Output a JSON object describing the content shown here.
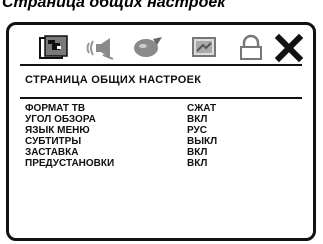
{
  "caption": "Страница общих настроек",
  "toolbar": {
    "icons": [
      {
        "name": "general-setup-icon",
        "selected": true
      },
      {
        "name": "audio-setup-icon",
        "selected": false
      },
      {
        "name": "video-setup-icon",
        "selected": false
      },
      {
        "name": "preference-setup-icon",
        "selected": false
      },
      {
        "name": "password-lock-icon",
        "selected": false
      },
      {
        "name": "exit-icon",
        "selected": false
      }
    ]
  },
  "page_title": "СТРАНИЦА ОБЩИХ НАСТРОЕК",
  "settings": [
    {
      "label": "ФОРМАТ ТВ",
      "value": "СЖАТ"
    },
    {
      "label": "УГОЛ ОБЗОРА",
      "value": "ВКЛ"
    },
    {
      "label": "ЯЗЫК МЕНЮ",
      "value": "РУС"
    },
    {
      "label": "СУБТИТРЫ",
      "value": "ВЫКЛ"
    },
    {
      "label": "ЗАСТАВКА",
      "value": "ВКЛ"
    },
    {
      "label": "ПРЕДУСТАНОВКИ",
      "value": "ВКЛ"
    }
  ],
  "colors": {
    "foreground": "#111111",
    "background": "#ffffff",
    "icon_gray": "#8a8a8a"
  }
}
